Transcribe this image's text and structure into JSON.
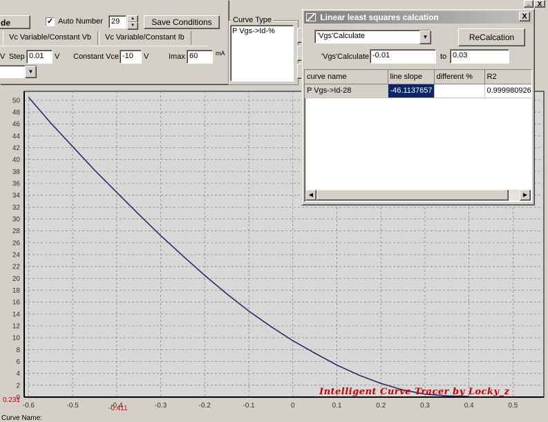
{
  "top": {
    "mode_tab": "de",
    "auto_number_label": "Auto Number",
    "auto_number_checked": true,
    "auto_number_value": "29",
    "save_conditions": "Save Conditions",
    "curve_type_label": "Curve Type",
    "curve_type_item": "P Vgs->Id-%",
    "tabs": [
      "Vc Variable/Constant Vb",
      "Vc Variable/Constant Ib"
    ],
    "v_label": "V",
    "step_label": "Step",
    "step_value": "0.01",
    "step_unit": "V",
    "vce_label": "Constant Vce",
    "vce_value": "-10",
    "vce_unit": "V",
    "imax_label": "Imax",
    "imax_value": "60",
    "imax_unit": "mA",
    "mini_btns": [
      "_",
      "X"
    ]
  },
  "dialog": {
    "title": "Linear least squares calcation",
    "close": "X",
    "select_value": "'Vgs'Calculate",
    "recalc": "ReCalcation",
    "range_label": "'Vgs'Calculate",
    "from_value": "-0.01",
    "to_label": "to",
    "to_value": "0.03",
    "columns": [
      "curve name",
      "line slope",
      "different %",
      "R2"
    ],
    "rows": [
      {
        "name": "P Vgs->Id-28",
        "slope": "-46.1137657",
        "diff": "",
        "r2": "0.999980926"
      }
    ]
  },
  "chart_data": {
    "type": "line",
    "x": [
      -0.6,
      -0.55,
      -0.5,
      -0.45,
      -0.4,
      -0.35,
      -0.3,
      -0.25,
      -0.2,
      -0.15,
      -0.1,
      -0.05,
      0,
      0.05,
      0.1,
      0.15,
      0.2,
      0.25,
      0.3,
      0.35,
      0.4
    ],
    "y": [
      50.5,
      46.2,
      42.2,
      38.2,
      34.5,
      30.8,
      27.2,
      23.8,
      20.5,
      17.4,
      14.5,
      11.9,
      9.5,
      7.4,
      5.4,
      3.7,
      2.3,
      1.2,
      0.5,
      0.2,
      0.1
    ],
    "xlim": [
      -0.61,
      0.57
    ],
    "ylim": [
      0,
      51.5
    ],
    "xticks": [
      "-0.6",
      "-0.5",
      "-0.4",
      "-0.3",
      "-0.2",
      "-0.1",
      "0",
      "0.1",
      "0.2",
      "0.3",
      "0.4",
      "0.5"
    ],
    "yticks": [
      "0",
      "2",
      "4",
      "6",
      "8",
      "10",
      "12",
      "14",
      "16",
      "18",
      "20",
      "22",
      "24",
      "26",
      "28",
      "30",
      "32",
      "34",
      "36",
      "38",
      "40",
      "42",
      "44",
      "46",
      "48",
      "50"
    ],
    "corner_value": "0.231",
    "cursor_value": "-0.411",
    "watermark": "Intelligent Curve Tracer by Locky_z",
    "curve_color": "#2a2a6a",
    "watermark_color": "#cc0000"
  },
  "status": {
    "curve_name_label": "Curve Name:"
  }
}
